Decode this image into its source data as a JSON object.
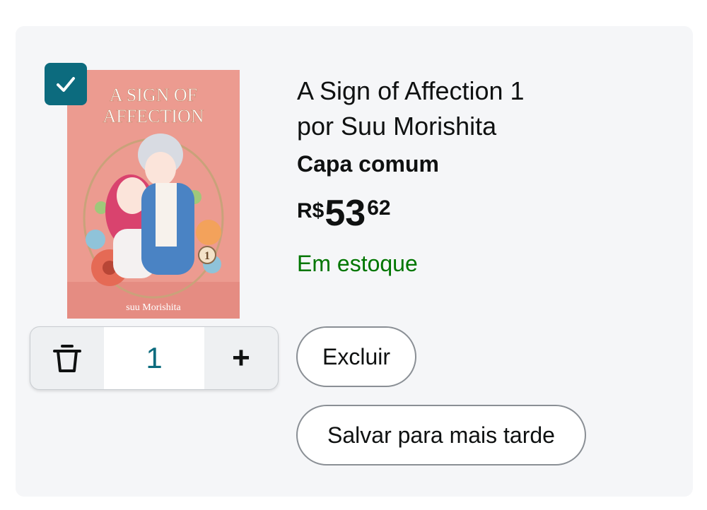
{
  "product": {
    "title_line1": "A Sign of Affection 1",
    "title_line2": "por Suu Morishita",
    "format": "Capa comum",
    "price": {
      "currency": "R$",
      "integer": "53",
      "decimal": "62"
    },
    "availability": "Em estoque",
    "cover": {
      "title_line1": "A SIGN OF",
      "title_line2": "AFFECTION",
      "volume": "1",
      "author": "suu Morishita"
    },
    "selected": true
  },
  "quantity": {
    "value": "1",
    "plus_label": "+"
  },
  "actions": {
    "delete_label": "Excluir",
    "save_later_label": "Salvar para mais tarde"
  },
  "colors": {
    "accent": "#0c6b7e",
    "stock_green": "#007600",
    "card_bg": "#f5f6f8",
    "cover_bg": "#ec9b90"
  }
}
